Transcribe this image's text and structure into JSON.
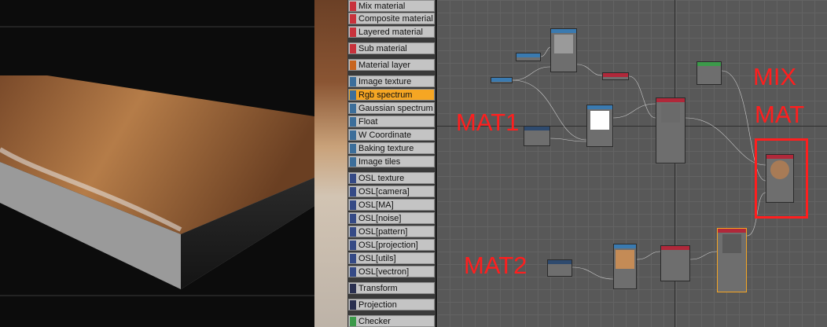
{
  "palette": {
    "items": [
      {
        "label": "Mix material",
        "swatch": "#c8323c"
      },
      {
        "label": "Composite material",
        "swatch": "#c8323c"
      },
      {
        "label": "Layered material",
        "swatch": "#c8323c"
      },
      {
        "label": "Sub material",
        "swatch": "#c8323c"
      },
      {
        "label": "Material layer",
        "swatch": "#c8651e"
      },
      {
        "label": "Image texture",
        "swatch": "#3c6e9a"
      },
      {
        "label": "Rgb spectrum",
        "swatch": "#3c6e9a"
      },
      {
        "label": "Gaussian spectrum",
        "swatch": "#3c6e9a"
      },
      {
        "label": "Float",
        "swatch": "#3c6e9a"
      },
      {
        "label": "W Coordinate",
        "swatch": "#3c6e9a"
      },
      {
        "label": "Baking texture",
        "swatch": "#3c6e9a"
      },
      {
        "label": "Image tiles",
        "swatch": "#3c6e9a"
      },
      {
        "label": "OSL texture",
        "swatch": "#354a86"
      },
      {
        "label": "OSL[camera]",
        "swatch": "#354a86"
      },
      {
        "label": "OSL[MA]",
        "swatch": "#354a86"
      },
      {
        "label": "OSL[noise]",
        "swatch": "#354a86"
      },
      {
        "label": "OSL[pattern]",
        "swatch": "#354a86"
      },
      {
        "label": "OSL[projection]",
        "swatch": "#354a86"
      },
      {
        "label": "OSL[utils]",
        "swatch": "#354a86"
      },
      {
        "label": "OSL[vectron]",
        "swatch": "#354a86"
      },
      {
        "label": "Transform",
        "swatch": "#2a3050"
      },
      {
        "label": "Projection",
        "swatch": "#2a3050"
      },
      {
        "label": "Checker",
        "swatch": "#3c9a4a"
      }
    ],
    "selected_label": "Rgb spectrum",
    "selected_color": "#f6a623"
  },
  "annotations": {
    "mix_line1": "MIX",
    "mix_line2": "MAT",
    "mat1": "MAT1",
    "mat2": "MAT2",
    "color": "#ff1e1e"
  },
  "colors": {
    "viewport_bg": "#0c0c0c",
    "graph_bg": "#585858",
    "node_body": "#6e6e6e",
    "wire": "#d8d8d8",
    "universal_header": "#b0283a",
    "image_header": "#3a7ab0",
    "mix_header": "#b0283a",
    "transform_header": "#2e4a6e",
    "output_border": "#f6a623"
  }
}
